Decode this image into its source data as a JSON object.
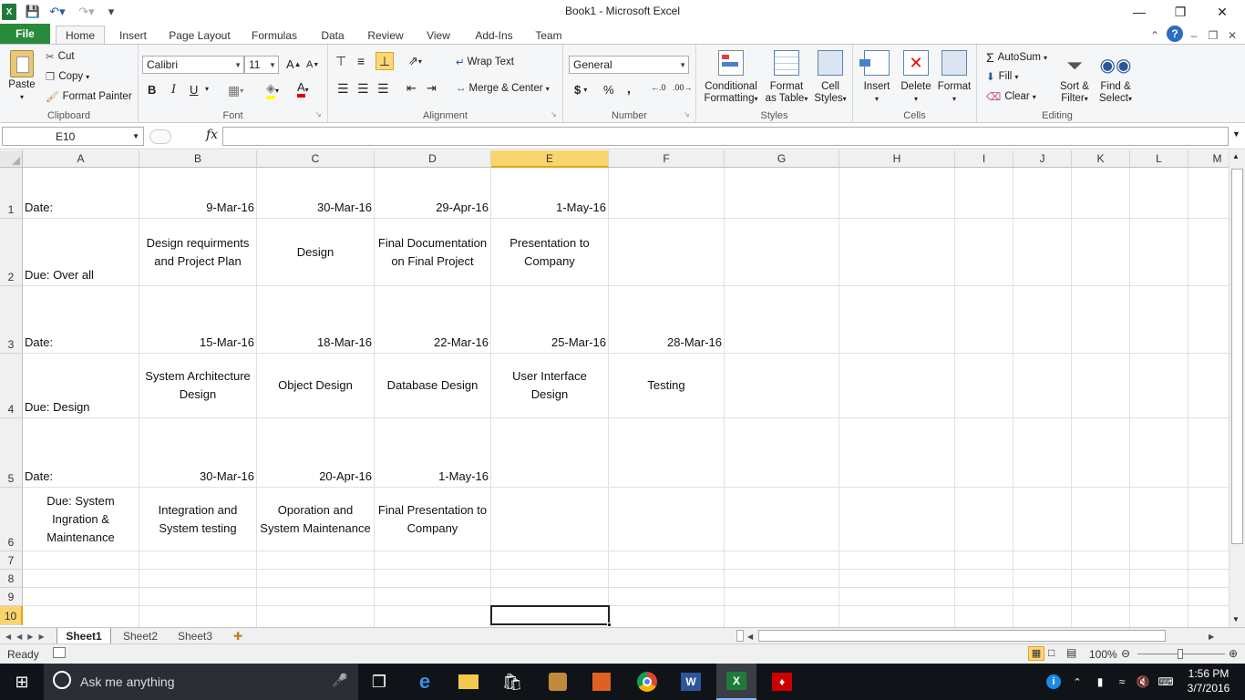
{
  "window": {
    "title": "Book1  -  Microsoft Excel"
  },
  "ribbon_tabs": [
    "File",
    "Home",
    "Insert",
    "Page Layout",
    "Formulas",
    "Data",
    "Review",
    "View",
    "Add-Ins",
    "Team"
  ],
  "clipboard": {
    "paste": "Paste",
    "cut": "Cut",
    "copy": "Copy",
    "format_painter": "Format Painter",
    "label": "Clipboard"
  },
  "font": {
    "name": "Calibri",
    "size": "11",
    "bold": "B",
    "italic": "I",
    "underline": "U",
    "label": "Font"
  },
  "alignment": {
    "wrap_text": "Wrap Text",
    "merge_center": "Merge & Center",
    "label": "Alignment"
  },
  "number": {
    "format": "General",
    "currency": "$",
    "percent": "%",
    "comma": ",",
    "label": "Number"
  },
  "styles": {
    "conditional": "Conditional",
    "conditional2": "Formatting",
    "format_table": "Format",
    "format_table2": "as Table",
    "cell_styles": "Cell",
    "cell_styles2": "Styles",
    "label": "Styles"
  },
  "cells": {
    "insert": "Insert",
    "delete": "Delete",
    "format": "Format",
    "label": "Cells"
  },
  "editing": {
    "autosum": "AutoSum",
    "fill": "Fill",
    "clear": "Clear",
    "sort": "Sort &",
    "sort2": "Filter",
    "find": "Find &",
    "find2": "Select",
    "label": "Editing"
  },
  "formula_bar": {
    "name_box": "E10",
    "fx": "fx",
    "value": ""
  },
  "columns": [
    "A",
    "B",
    "C",
    "D",
    "E",
    "F",
    "G",
    "H",
    "I",
    "J",
    "K",
    "L",
    "M"
  ],
  "rows": [
    "1",
    "2",
    "3",
    "4",
    "5",
    "6",
    "7",
    "8",
    "9",
    "10"
  ],
  "cells_data": {
    "A1": "Date:",
    "B1": "9-Mar-16",
    "C1": "30-Mar-16",
    "D1": "29-Apr-16",
    "E1": "1-May-16",
    "A2": "Due: Over all",
    "B2": "Design requirments and Project Plan",
    "C2": "Design",
    "D2": "Final Documentation on Final Project",
    "E2": "Presentation to Company",
    "A3": "Date:",
    "B3": "15-Mar-16",
    "C3": "18-Mar-16",
    "D3": "22-Mar-16",
    "E3": "25-Mar-16",
    "F3": "28-Mar-16",
    "A4": "Due: Design",
    "B4": "System Architecture Design",
    "C4": "Object Design",
    "D4": "Database Design",
    "E4": "User Interface Design",
    "F4": "Testing",
    "A5": "Date:",
    "B5": "30-Mar-16",
    "C5": "20-Apr-16",
    "D5": "1-May-16",
    "A6": "Due: System Ingration & Maintenance",
    "B6": "Integration and System testing",
    "C6": "Oporation and System Maintenance",
    "D6": "Final Presentation to Company"
  },
  "sheets": [
    "Sheet1",
    "Sheet2",
    "Sheet3"
  ],
  "status": {
    "ready": "Ready",
    "zoom": "100%"
  },
  "taskbar": {
    "search_placeholder": "Ask me anything",
    "time": "1:56 PM",
    "date": "3/7/2016"
  },
  "colors": {
    "excel_green": "#2a8a3c",
    "selected_col": "#f9d56e",
    "taskbar": "#101418"
  }
}
